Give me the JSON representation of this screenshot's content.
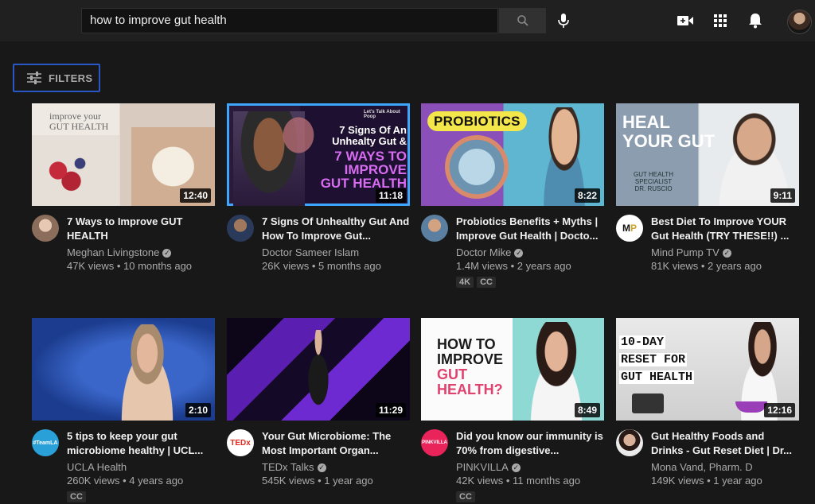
{
  "search": {
    "query": "how to improve gut health"
  },
  "filters": {
    "label": "FILTERS"
  },
  "videos": [
    {
      "title": "7 Ways to Improve GUT HEALTH",
      "channel": "Meghan Livingstone",
      "verified": true,
      "stats": "47K views • 10 months ago",
      "duration": "12:40",
      "thumb_text": [
        "improve your",
        "GUT HEALTH"
      ],
      "badges": []
    },
    {
      "title": "7 Signs Of Unhealthy Gut And How To Improve Gut...",
      "channel": "Doctor Sameer Islam",
      "verified": false,
      "stats": "26K views • 5 months ago",
      "duration": "11:18",
      "thumb_text": [
        "Let's Talk About Poop",
        "7 Signs Of An",
        "Unhealty Gut &",
        "7 WAYS TO",
        "IMPROVE",
        "GUT HEALTH"
      ],
      "badges": []
    },
    {
      "title": "Probiotics Benefits + Myths | Improve Gut Health | Docto...",
      "channel": "Doctor Mike",
      "verified": true,
      "stats": "1.4M views • 2 years ago",
      "duration": "8:22",
      "thumb_text": [
        "PROBIOTICS"
      ],
      "badges": [
        "4K",
        "CC"
      ]
    },
    {
      "title": "Best Diet To Improve YOUR Gut Health (TRY THESE!!) ...",
      "channel": "Mind Pump TV",
      "verified": true,
      "stats": "81K views • 2 years ago",
      "duration": "9:11",
      "thumb_text": [
        "HEAL",
        "YOUR GUT",
        "GUT HEALTH",
        "SPECIALIST",
        "DR. RUSCIO"
      ],
      "badges": []
    },
    {
      "title": "5 tips to keep your gut microbiome healthy | UCL...",
      "channel": "UCLA Health",
      "verified": false,
      "stats": "260K views • 4 years ago",
      "duration": "2:10",
      "thumb_text": [
        "#TeamLA"
      ],
      "badges": [
        "CC"
      ]
    },
    {
      "title": "Your Gut Microbiome: The Most Important Organ...",
      "channel": "TEDx Talks",
      "verified": true,
      "stats": "545K views • 1 year ago",
      "duration": "11:29",
      "thumb_text": [
        "TEDx"
      ],
      "badges": []
    },
    {
      "title": "Did you know our immunity is 70% from digestive...",
      "channel": "PINKVILLA",
      "verified": true,
      "stats": "42K views • 11 months ago",
      "duration": "8:49",
      "thumb_text": [
        "HOW TO",
        "IMPROVE",
        "GUT",
        "HEALTH?",
        "PINKVILLA"
      ],
      "badges": [
        "CC"
      ]
    },
    {
      "title": "Gut Healthy Foods and Drinks - Gut Reset Diet | Dr...",
      "channel": "Mona Vand, Pharm. D",
      "verified": false,
      "stats": "149K views • 1 year ago",
      "duration": "12:16",
      "thumb_text": [
        "10-DAY",
        "RESET FOR",
        "GUT HEALTH"
      ],
      "badges": []
    }
  ]
}
